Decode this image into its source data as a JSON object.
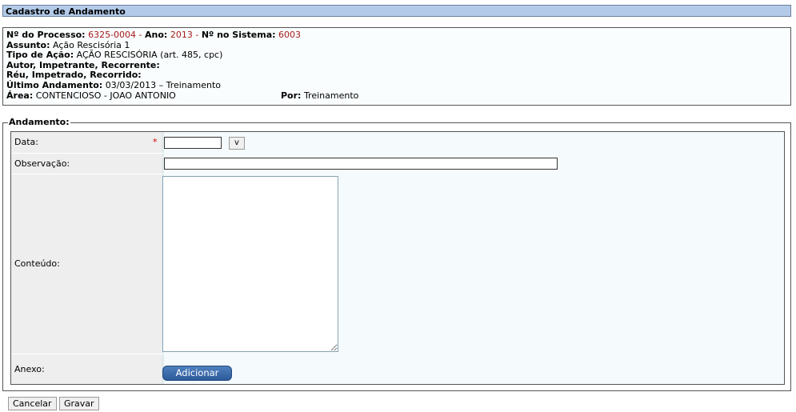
{
  "header": {
    "title": "Cadastro de Andamento"
  },
  "info": {
    "processo_label": "Nº do Processo:",
    "processo_value": "6325-0004",
    "ano_label": "Ano:",
    "ano_value": "2013",
    "sistema_label": "Nº no Sistema:",
    "sistema_value": "6003",
    "assunto_label": "Assunto:",
    "assunto_value": "Ação Rescisória 1",
    "tipo_label": "Tipo de Ação:",
    "tipo_value": "AÇÃO RESCISÓRIA (art. 485, cpc)",
    "autor_label": "Autor, Impetrante, Recorrente:",
    "reu_label": "Réu, Impetrado, Recorrido:",
    "ultimo_label": "Último Andamento:",
    "ultimo_value": "03/03/2013 – Treinamento",
    "area_label": "Área:",
    "area_value": "CONTENCIOSO - JOAO ANTONIO",
    "por_label": "Por:",
    "por_value": "Treinamento"
  },
  "form": {
    "legend": "Andamento:",
    "data_label": "Data:",
    "required_mark": "*",
    "data_value": "",
    "calendar_button": "v",
    "observacao_label": "Observação:",
    "observacao_value": "",
    "conteudo_label": "Conteúdo:",
    "conteudo_value": "",
    "anexo_label": "Anexo:",
    "adicionar_label": "Adicionar"
  },
  "actions": {
    "cancelar_label": "Cancelar",
    "gravar_label": "Gravar"
  }
}
